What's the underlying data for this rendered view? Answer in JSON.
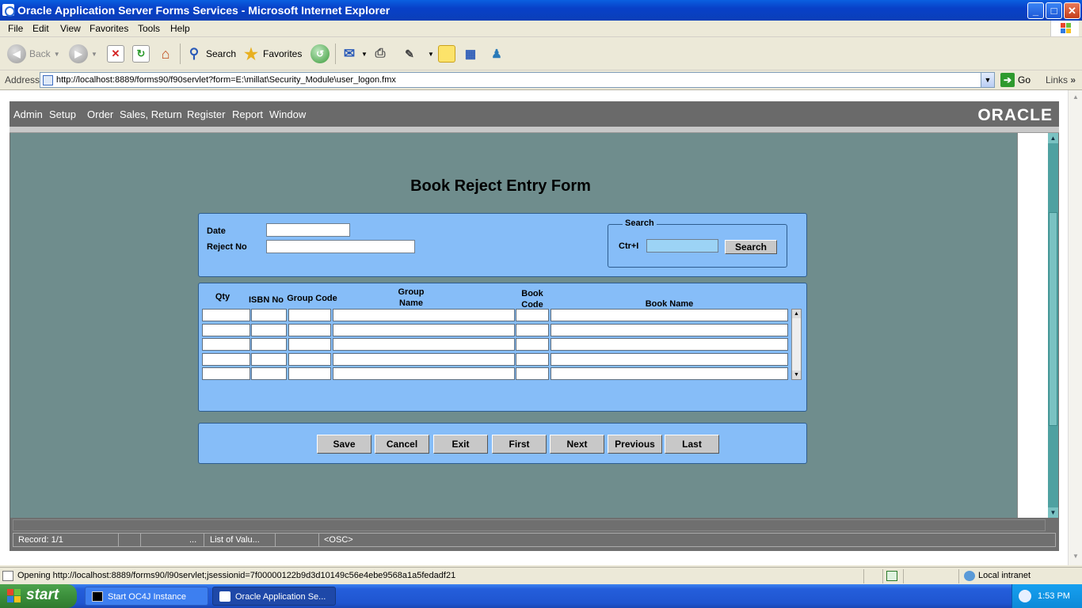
{
  "window": {
    "title": "Oracle Application Server Forms Services - Microsoft Internet Explorer",
    "buttons": {
      "minimize": "_",
      "maximize": "□",
      "close": "✕"
    }
  },
  "menubar": {
    "items": [
      "File",
      "Edit",
      "View",
      "Favorites",
      "Tools",
      "Help"
    ]
  },
  "toolbar": {
    "back": "Back",
    "search": "Search",
    "favorites": "Favorites"
  },
  "address": {
    "label": "Address",
    "url": "http://localhost:8889/forms90/f90servlet?form=E:\\millat\\Security_Module\\user_logon.fmx",
    "go": "Go",
    "links": "Links"
  },
  "oracle_menu": {
    "items": [
      "Admin",
      "Setup",
      "Order",
      "Sales, Return",
      "Register",
      "Report",
      "Window"
    ],
    "logo": "ORACLE"
  },
  "form": {
    "title": "Book Reject Entry Form",
    "date_label": "Date",
    "date_value": "",
    "reject_label": "Reject No",
    "reject_value": "",
    "search_legend": "Search",
    "search_label": "Ctr+I",
    "search_value": "",
    "search_button": "Search"
  },
  "grid": {
    "columns": [
      {
        "line1": "Qty",
        "line2": ""
      },
      {
        "line1": "ISBN No",
        "line2": ""
      },
      {
        "line1": "Group Code",
        "line2": ""
      },
      {
        "line1": "Group",
        "line2": "Name"
      },
      {
        "line1": "Book",
        "line2": "Code"
      },
      {
        "line1": "Book Name",
        "line2": ""
      }
    ],
    "row_count": 5
  },
  "actions": {
    "save": "Save",
    "cancel": "Cancel",
    "exit": "Exit",
    "first": "First",
    "next": "Next",
    "previous": "Previous",
    "last": "Last"
  },
  "forms_status": {
    "record": "Record: 1/1",
    "ellipsis": "...",
    "lov": "List of Valu...",
    "osc": "<OSC>"
  },
  "ie_status": {
    "message": "Opening http://localhost:8889/forms90/l90servlet;jsessionid=7f00000122b9d3d10149c56e4ebe9568a1a5fedadf21",
    "zone": "Local intranet"
  },
  "taskbar": {
    "start": "start",
    "tasks": [
      "Start OC4J Instance",
      "Oracle Application Se..."
    ],
    "clock": "1:53 PM"
  }
}
